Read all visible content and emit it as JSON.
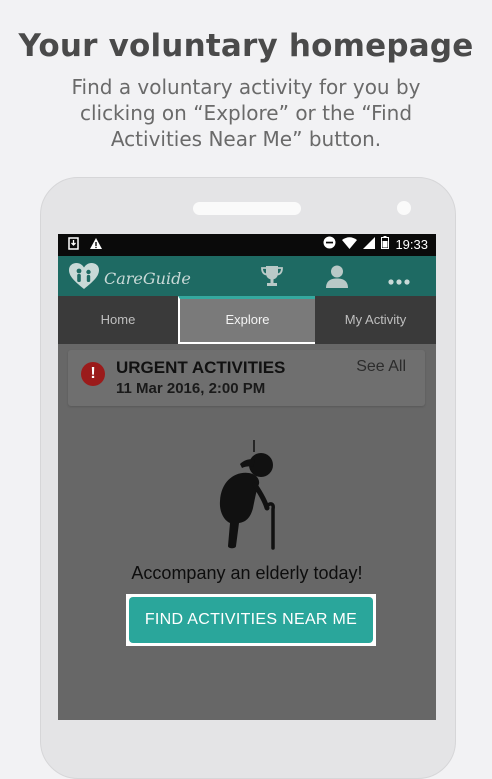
{
  "promo": {
    "headline": "Your voluntary homepage",
    "subline": "Find a voluntary activity for you by clicking on “Explore” or the “Find Activities Near Me” button."
  },
  "status_bar": {
    "time": "19:33",
    "icons": [
      "download-icon",
      "warning-icon",
      "minus-circle-icon",
      "wifi-icon",
      "signal-icon",
      "battery-icon"
    ]
  },
  "app_bar": {
    "app_name": "CareGuide",
    "icons": [
      "trophy-icon",
      "profile-icon",
      "more-icon"
    ],
    "brand_color": "#1e6a63"
  },
  "tabs": [
    {
      "label": "Home",
      "active": false
    },
    {
      "label": "Explore",
      "active": true
    },
    {
      "label": "My Activity",
      "active": false
    }
  ],
  "urgent": {
    "title": "URGENT ACTIVITIES",
    "date": "11 Mar 2016, 2:00 PM",
    "see_all": "See All",
    "icon": "exclamation-icon",
    "icon_color": "#9b1b1b"
  },
  "main": {
    "illustration": "elderly-person-icon",
    "tagline": "Accompany an elderly today!",
    "find_button": "FIND ACTIVITIES NEAR ME",
    "accent": "#2aa69b"
  }
}
